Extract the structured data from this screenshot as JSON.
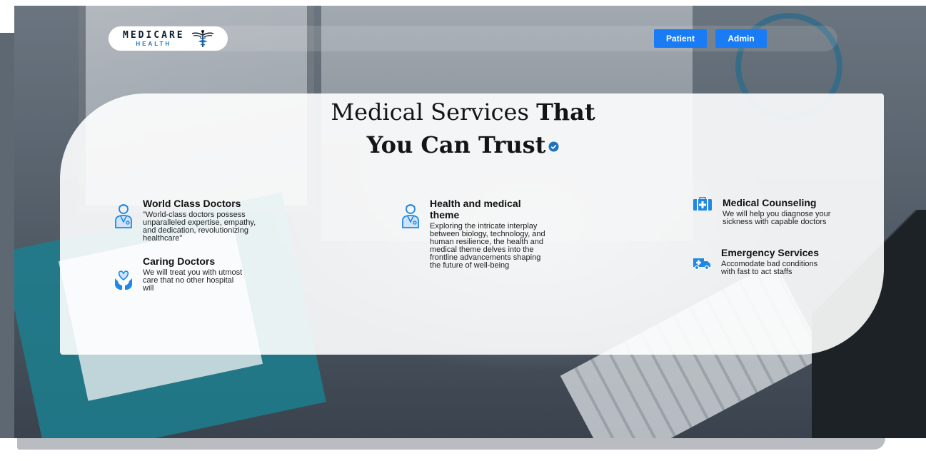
{
  "brand": {
    "name": "MEDICARE",
    "subtitle": "HEALTH"
  },
  "nav": {
    "patient_label": "Patient",
    "admin_label": "Admin"
  },
  "hero": {
    "title_part1": "Medical Services ",
    "title_part2": "That",
    "title_line2": "You Can Trust"
  },
  "features": {
    "world_class": {
      "title": "World Class Doctors",
      "text": "\"World-class doctors possess unparalleled expertise, empathy, and dedication, revolutionizing healthcare\""
    },
    "caring": {
      "title": "Caring Doctors",
      "text": "We will treat you with utmost care that no other hospital will"
    },
    "health_theme": {
      "title": "Health and medical theme",
      "text": "Exploring the intricate interplay between biology, technology, and human resilience, the health and medical theme delves into the frontline advancements shaping the future of well-being"
    },
    "counseling": {
      "title": "Medical Counseling",
      "text": "We will help you diagnose your sickness with capable doctors"
    },
    "emergency": {
      "title": "Emergency Services",
      "text": "Accomodate bad conditions with fast to act staffs"
    }
  },
  "colors": {
    "accent": "#1a7cf4",
    "icon_blue": "#1e88e5"
  },
  "icons": {
    "doctor": "doctor-icon",
    "caring": "caring-hands-icon",
    "counseling": "medical-kit-icon",
    "emergency": "ambulance-icon",
    "verified": "check-badge-icon"
  }
}
